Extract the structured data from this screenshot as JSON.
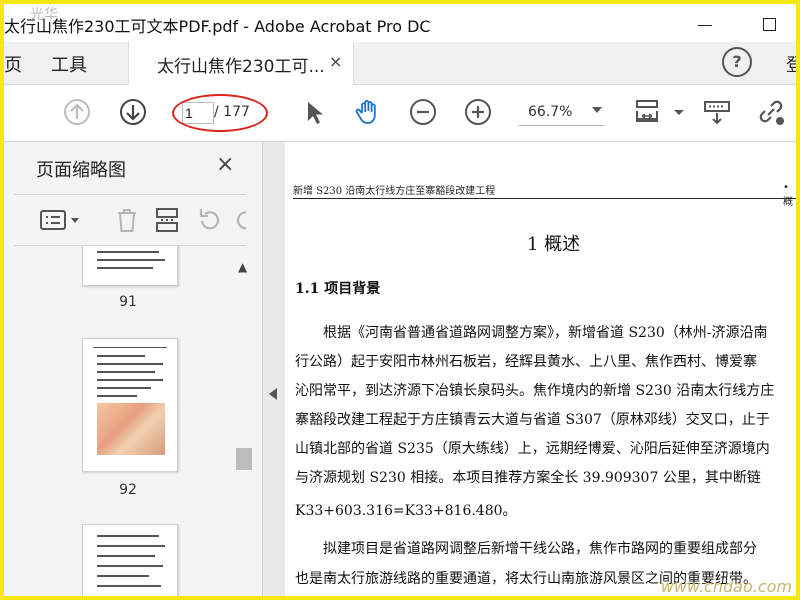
{
  "window": {
    "title": "太行山焦作230工可文本PDF.pdf - Adobe Acrobat Pro DC"
  },
  "menubar": {
    "home_partial": "页",
    "tools": "工具",
    "tab_label": "太行山焦作230工可...",
    "tab_close": "×",
    "help": "?",
    "login_partial": "登"
  },
  "toolbar": {
    "page_current": "1",
    "page_total": "/ 177",
    "zoom": "66.7%"
  },
  "sidepanel": {
    "title": "页面缩略图",
    "close": "×",
    "pages": [
      "91",
      "92"
    ]
  },
  "document": {
    "header_left": "新增 S230 沿南太行线方庄至寨豁段改建工程",
    "header_right": "• 概",
    "heading": "1  概述",
    "subheading": "1.1  项目背景",
    "lines": [
      "　　根据《河南省普通省道路网调整方案》，新增省道 S230（林州-济源沿南",
      "行公路）起于安阳市林州石板岩，经辉县黄水、上八里、焦作西村、博爱寨",
      "沁阳常平，到达济源下冶镇长泉码头。焦作境内的新增 S230 沿南太行线方庄",
      "寨豁段改建工程起于方庄镇青云大道与省道 S307（原林邓线）交叉口，止于",
      "山镇北部的省道 S235（原大练线）上，远期经博爱、沁阳后延伸至济源境内",
      "与济源规划 S230 相接。本项目推荐方案全长 39.909307 公里，其中断链",
      "K33+603.316=K33+816.480。",
      "　　拟建项目是省道路网调整后新增干线公路，焦作市路网的重要组成部分",
      "也是南太行旅游线路的重要通道，将太行山南旅游风景区之间的重要纽带。"
    ]
  },
  "watermark": "www.cndao.com",
  "watermark_top": "光华"
}
